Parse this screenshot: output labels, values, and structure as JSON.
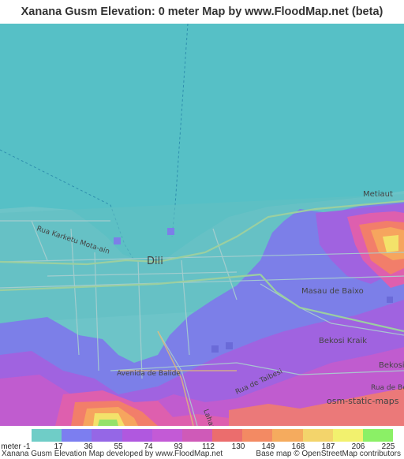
{
  "title": "Xanana Gusm Elevation: 0 meter Map by www.FloodMap.net (beta)",
  "map": {
    "city_label": "Dili",
    "place_labels": [
      "Metiaut",
      "Masau de Baixo",
      "Bekosi Kraik",
      "Bekosi",
      "Rua de Becu",
      "osm-static-maps"
    ],
    "road_labels": [
      "Rua Karketu Mota-ain",
      "Avenida de Balide",
      "Rua de Taibesi",
      "Lahane"
    ],
    "colors": {
      "sea": "#56c0c6",
      "land_low": "#7c7fe8",
      "purple": "#a063e0",
      "magenta": "#c05ccf",
      "pink": "#de5fae",
      "salmon": "#f27e6a",
      "orange": "#f6a55e",
      "yellow": "#f3e26a",
      "green": "#94e26a"
    }
  },
  "legend": {
    "unit_label": "meter",
    "ticks": [
      "-1",
      "17",
      "36",
      "55",
      "74",
      "93",
      "112",
      "130",
      "149",
      "168",
      "187",
      "206",
      "225"
    ],
    "colors": [
      "#6fcdc7",
      "#7c7ef0",
      "#9567e6",
      "#b058df",
      "#c35ad6",
      "#cf5ab8",
      "#eb6d6d",
      "#f38a63",
      "#f5ab5e",
      "#f3d46b",
      "#f2f16e",
      "#8bf066"
    ],
    "extra_color": "#7ed56a"
  },
  "footer": {
    "left": "Xanana Gusm Elevation Map developed by www.FloodMap.net",
    "right": "Base map © OpenStreetMap contributors"
  }
}
